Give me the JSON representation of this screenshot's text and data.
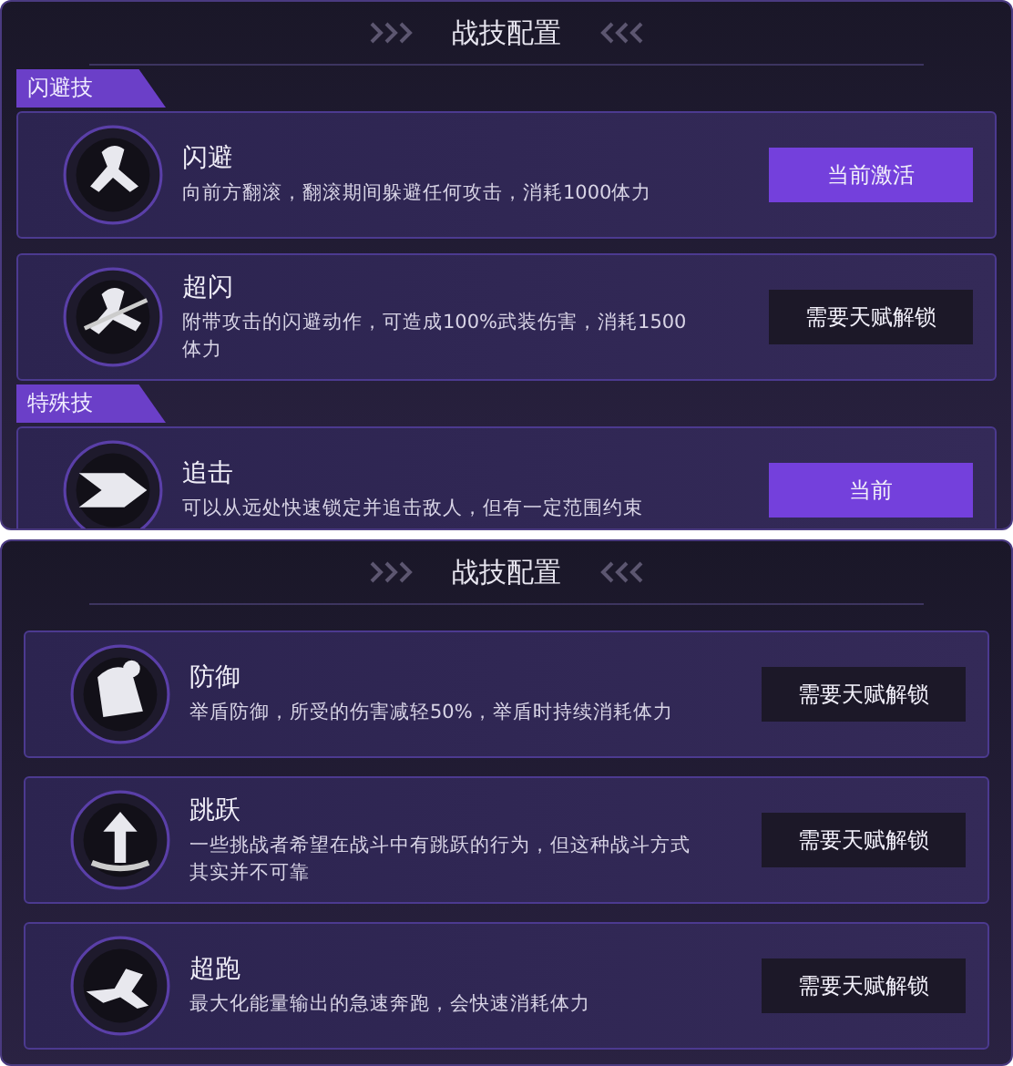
{
  "panels": [
    {
      "title": "战技配置",
      "sections": [
        {
          "label": "闪避技",
          "skills": [
            {
              "name": "闪避",
              "description": "向前方翻滚，翻滚期间躲避任何攻击，消耗1000体力",
              "button": {
                "label": "当前激活",
                "kind": "active"
              }
            },
            {
              "name": "超闪",
              "description": "附带攻击的闪避动作，可造成100%武装伤害，消耗1500体力",
              "button": {
                "label": "需要天赋解锁",
                "kind": "locked"
              }
            }
          ]
        },
        {
          "label": "特殊技",
          "skills": [
            {
              "name": "追击",
              "description": "可以从远处快速锁定并追击敌人，但有一定范围约束",
              "button": {
                "label": "当前",
                "kind": "active"
              }
            }
          ]
        }
      ]
    },
    {
      "title": "战技配置",
      "sections": [
        {
          "skills": [
            {
              "name": "防御",
              "description": "举盾防御，所受的伤害减轻50%，举盾时持续消耗体力",
              "button": {
                "label": "需要天赋解锁",
                "kind": "locked"
              }
            },
            {
              "name": "跳跃",
              "description": "一些挑战者希望在战斗中有跳跃的行为，但这种战斗方式其实并不可靠",
              "button": {
                "label": "需要天赋解锁",
                "kind": "locked"
              }
            },
            {
              "name": "超跑",
              "description": "最大化能量输出的急速奔跑，会快速消耗体力",
              "button": {
                "label": "需要天赋解锁",
                "kind": "locked"
              }
            }
          ]
        }
      ]
    }
  ]
}
